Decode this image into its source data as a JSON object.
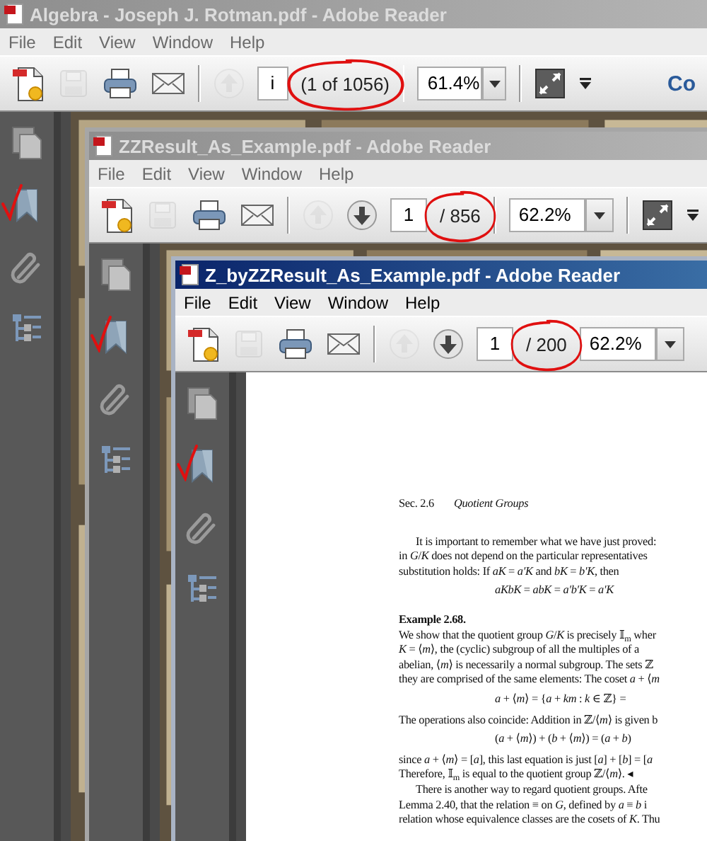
{
  "windows": [
    {
      "title": "Algebra - Joseph J. Rotman.pdf - Adobe Reader",
      "active": false,
      "menu": [
        "File",
        "Edit",
        "View",
        "Window",
        "Help"
      ],
      "toolbar": [
        {
          "kind": "create",
          "disabled": false
        },
        {
          "kind": "save",
          "disabled": true
        },
        {
          "kind": "print",
          "disabled": false
        },
        {
          "kind": "email",
          "disabled": false
        },
        {
          "kind": "separator"
        },
        {
          "kind": "previous",
          "disabled": true
        },
        {
          "kind": "page_field",
          "value": "i"
        },
        {
          "kind": "page_count",
          "text": "(1 of 1056)",
          "circled": true
        },
        {
          "kind": "separator"
        },
        {
          "kind": "zoom_field",
          "value": "61.4%"
        },
        {
          "kind": "zoom_menu"
        },
        {
          "kind": "separator"
        },
        {
          "kind": "fullscreen",
          "disabled": false
        },
        {
          "kind": "more"
        },
        {
          "kind": "label",
          "text": "Co"
        }
      ],
      "sidebar": [
        {
          "kind": "pages",
          "marked": false
        },
        {
          "kind": "bookmarks",
          "marked": true
        },
        {
          "kind": "attachments",
          "marked": false
        },
        {
          "kind": "layers",
          "marked": false
        }
      ],
      "document": {
        "kind": "picture"
      }
    },
    {
      "title": "ZZResult_As_Example.pdf - Adobe Reader",
      "active": false,
      "menu": [
        "File",
        "Edit",
        "View",
        "Window",
        "Help"
      ],
      "toolbar": [
        {
          "kind": "create",
          "disabled": false
        },
        {
          "kind": "save",
          "disabled": true
        },
        {
          "kind": "print",
          "disabled": false
        },
        {
          "kind": "email",
          "disabled": false
        },
        {
          "kind": "separator"
        },
        {
          "kind": "previous",
          "disabled": true
        },
        {
          "kind": "next",
          "disabled": false
        },
        {
          "kind": "page_field",
          "value": "1"
        },
        {
          "kind": "page_count",
          "text": "/ 856",
          "circled": true
        },
        {
          "kind": "separator"
        },
        {
          "kind": "zoom_field",
          "value": "62.2%"
        },
        {
          "kind": "zoom_menu"
        },
        {
          "kind": "separator"
        },
        {
          "kind": "fullscreen",
          "disabled": false
        },
        {
          "kind": "more"
        }
      ],
      "sidebar": [
        {
          "kind": "pages",
          "marked": false
        },
        {
          "kind": "bookmarks",
          "marked": true
        },
        {
          "kind": "attachments",
          "marked": false
        },
        {
          "kind": "layers",
          "marked": false
        }
      ],
      "document": {
        "kind": "picture"
      }
    },
    {
      "title": "Z_byZZResult_As_Example.pdf - Adobe Reader",
      "active": true,
      "menu": [
        "File",
        "Edit",
        "View",
        "Window",
        "Help"
      ],
      "toolbar": [
        {
          "kind": "create",
          "disabled": false
        },
        {
          "kind": "save",
          "disabled": true
        },
        {
          "kind": "print",
          "disabled": false
        },
        {
          "kind": "email",
          "disabled": false
        },
        {
          "kind": "separator"
        },
        {
          "kind": "previous",
          "disabled": true
        },
        {
          "kind": "next",
          "disabled": false
        },
        {
          "kind": "page_field",
          "value": "1"
        },
        {
          "kind": "page_count",
          "text": "/ 200",
          "circled": true
        },
        {
          "kind": "zoom_field",
          "value": "62.2%"
        },
        {
          "kind": "zoom_menu"
        }
      ],
      "sidebar": [
        {
          "kind": "pages",
          "marked": false
        },
        {
          "kind": "bookmarks",
          "marked": true
        },
        {
          "kind": "attachments",
          "marked": false
        },
        {
          "kind": "layers",
          "marked": false
        }
      ],
      "document": {
        "kind": "page",
        "running_head": {
          "section": "Sec. 2.6",
          "title": "Quotient Groups"
        },
        "blocks": [
          {
            "kind": "paragraph",
            "indent": true,
            "lines": [
              "It is important to remember what we have just proved:",
              "in *G*/*K* does not depend on the particular representatives",
              "substitution holds: If *aK* = *a′K* and *bK* = *b′K*, then"
            ]
          },
          {
            "kind": "display",
            "text": "*aKbK* = *abK* = *a′b′K* = *a′K*"
          },
          {
            "kind": "heading",
            "text": "Example 2.68."
          },
          {
            "kind": "paragraph",
            "indent": false,
            "lines": [
              "We show that the quotient group *G*/*K* is precisely 𝕀$_{m}$ wher",
              "*K* = ⟨*m*⟩, the (cyclic) subgroup of all the multiples of a",
              "abelian, ⟨*m*⟩ is necessarily a normal subgroup. The sets ℤ",
              "they are comprised of the same elements: The coset *a* + ⟨*m*"
            ]
          },
          {
            "kind": "display",
            "text": "*a* + ⟨*m*⟩ = {*a* + *km* : *k* ∈ ℤ} ="
          },
          {
            "kind": "paragraph",
            "indent": false,
            "lines": [
              "The operations also coincide: Addition in ℤ/⟨*m*⟩ is given b"
            ]
          },
          {
            "kind": "display",
            "text": "(*a* + ⟨*m*⟩) + (*b* + ⟨*m*⟩) = (*a* + *b*)"
          },
          {
            "kind": "paragraph",
            "indent": false,
            "lines": [
              "since *a* + ⟨*m*⟩ = [*a*], this last equation is just [*a*] + [*b*] = [*a*",
              "Therefore, 𝕀$_{m}$ is equal to the quotient group ℤ/⟨*m*⟩.   ◂"
            ]
          },
          {
            "kind": "paragraph",
            "indent": true,
            "lines": [
              "There is another way to regard quotient groups.  Afte",
              "Lemma 2.40, that the relation ≡ on *G*, defined by *a* ≡ *b* i",
              "relation whose equivalence classes are the cosets of *K*. Thu"
            ]
          }
        ]
      }
    }
  ]
}
